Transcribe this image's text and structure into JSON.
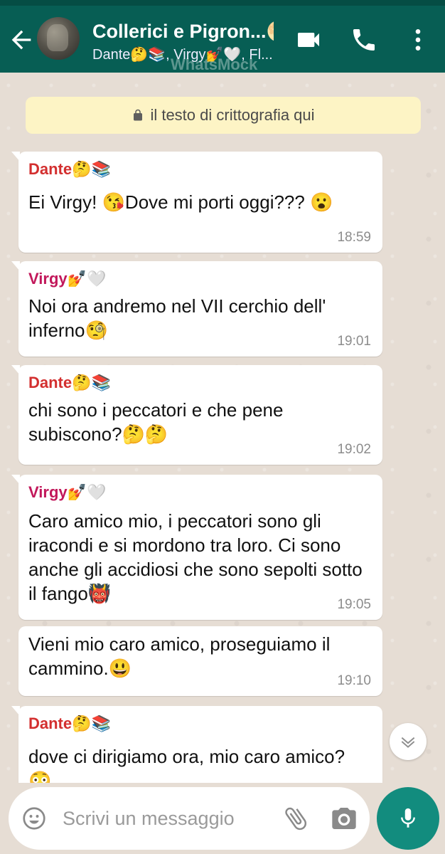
{
  "header": {
    "title": "Collerici e Pigron...🌖",
    "subtitle": "Dante🤔📚, Virgy💅🤍, Fl...🌖",
    "watermark": "WhatsMock"
  },
  "icons": {
    "back": "arrow-left-icon",
    "video": "video-call-icon",
    "call": "phone-icon",
    "menu": "more-vert-icon"
  },
  "chat": {
    "encryption_notice": "il testo di crittografia qui",
    "messages": [
      {
        "sender": "Dante🤔📚",
        "sender_color": "#d32f2f",
        "text": "Ei Virgy! 😘Dove mi porti oggi??? 😮",
        "time": "18:59"
      },
      {
        "sender": "Virgy💅🤍",
        "sender_color": "#c2185b",
        "text": "Noi ora andremo nel VII cerchio dell' inferno🧐",
        "time": "19:01"
      },
      {
        "sender": "Dante🤔📚",
        "sender_color": "#d32f2f",
        "text": "chi sono i peccatori e che pene subiscono?🤔🤔",
        "time": "19:02"
      },
      {
        "sender": "Virgy💅🤍",
        "sender_color": "#c2185b",
        "text": "Caro amico mio, i peccatori sono gli iracondi e si mordono tra loro. Ci sono anche gli accidiosi che sono sepolti sotto il fango👹",
        "time": "19:05"
      },
      {
        "sender": "",
        "sender_color": "#c2185b",
        "text": "Vieni mio caro amico, proseguiamo il cammino.😃",
        "time": "19:10"
      },
      {
        "sender": "Dante🤔📚",
        "sender_color": "#d32f2f",
        "text": "dove ci dirigiamo ora, mio caro amico? 😳",
        "time": ""
      }
    ]
  },
  "input": {
    "placeholder": "Scrivi un messaggio"
  },
  "colors": {
    "header": "#075e54",
    "accent": "#128c7e",
    "encryption_bg": "#fdf4c5"
  }
}
